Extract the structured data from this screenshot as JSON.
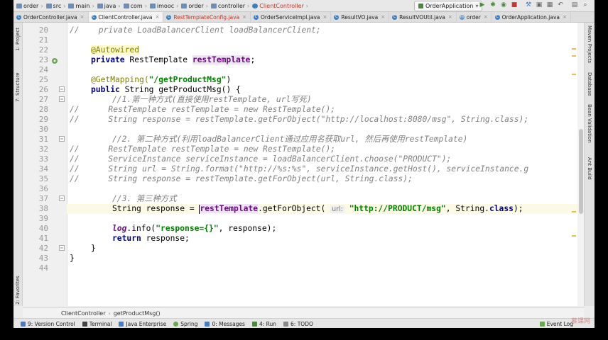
{
  "navbar": {
    "crumbs": [
      {
        "label": "order",
        "color": "#6b8fb8"
      },
      {
        "label": "src",
        "color": "#6b8fb8"
      },
      {
        "label": "main",
        "color": "#6b8fb8"
      },
      {
        "label": "java",
        "color": "#6b8fb8"
      },
      {
        "label": "com",
        "color": "#6b8fb8"
      },
      {
        "label": "imooc",
        "color": "#6b8fb8"
      },
      {
        "label": "order",
        "color": "#6b8fb8"
      },
      {
        "label": "controller",
        "color": "#6b8fb8"
      },
      {
        "label": "ClientController",
        "color": "#3a7fc1"
      }
    ],
    "run_config": "OrderApplication"
  },
  "tabs": [
    {
      "label": "OrderController.java",
      "active": false
    },
    {
      "label": "ClientController.java",
      "active": true
    },
    {
      "label": "RestTemplateConfig.java",
      "active": false
    },
    {
      "label": "OrderServiceImpl.java",
      "active": false
    },
    {
      "label": "ResultVO.java",
      "active": false
    },
    {
      "label": "ResultVOUtil.java",
      "active": false
    },
    {
      "label": "order",
      "active": false
    },
    {
      "label": "OrderApplication.java",
      "active": false
    }
  ],
  "left_tools": [
    "1: Project",
    "7: Structure",
    "2: Favorites"
  ],
  "right_tools": [
    "Maven Projects",
    "Database",
    "Bean Validation",
    "Ant Build"
  ],
  "editor": {
    "line_numbers": [
      "20",
      "21",
      "22",
      "23",
      "24",
      "25",
      "26",
      "27",
      "28",
      "29",
      "30",
      "31",
      "32",
      "33",
      "34",
      "35",
      "36",
      "37",
      "38",
      "39",
      "40",
      "41",
      "42",
      "43",
      "44"
    ],
    "lines": {
      "l20": "//    private LoadBalancerClient loadBalancerClient;",
      "l22_ann": "@Autowired",
      "l23_a": "private",
      "l23_b": " RestTemplate ",
      "l23_c": "restTemplate",
      "l23_d": ";",
      "l25_ann": "@GetMapping(",
      "l25_str": "\"/getProductMsg\"",
      "l25_end": ")",
      "l26_a": "public",
      "l26_b": " String getProductMsg() {",
      "l27": "//1.第一种方式(直接使用restTemplate, url写死)",
      "l28": "//      RestTemplate restTemplate = new RestTemplate();",
      "l29": "//      String response = restTemplate.getForObject(\"http://localhost:8080/msg\", String.class);",
      "l31": "//2. 第二种方式(利用loadBalancerClient通过应用名获取url, 然后再使用restTemplate)",
      "l32": "//      RestTemplate restTemplate = new RestTemplate();",
      "l33": "//      ServiceInstance serviceInstance = loadBalancerClient.choose(\"PRODUCT\");",
      "l34": "//      String url = String.format(\"http://%s:%s\", serviceInstance.getHost(), serviceInstance.g",
      "l35": "//      String response = restTemplate.getForObject(url, String.class);",
      "l37": "//3. 第三种方式",
      "l38_a": "String response = ",
      "l38_b": "restTemplate",
      "l38_c": ".getForObject( ",
      "l38_hint": "url:",
      "l38_str": "\"http://PRODUCT/msg\"",
      "l38_d": ", String.",
      "l38_kw": "class",
      "l38_e": ");",
      "l40_log": "log",
      "l40_a": ".info(",
      "l40_str": "\"response={}\"",
      "l40_b": ", response);",
      "l41_kw": "return",
      "l41_b": " response;",
      "l42": "}",
      "l43": "}"
    }
  },
  "method_breadcrumb": [
    "ClientController",
    "getProductMsg()"
  ],
  "tool_windows": [
    {
      "label": "9: Version Control",
      "color": "#4a7dbf"
    },
    {
      "label": "Terminal",
      "color": "#444444"
    },
    {
      "label": "Java Enterprise",
      "color": "#4a7dbf"
    },
    {
      "label": "Spring",
      "color": "#6aa84f"
    },
    {
      "label": "0: Messages",
      "color": "#4a7dbf"
    },
    {
      "label": "4: Run",
      "color": "#4a8b3a"
    },
    {
      "label": "6: TODO",
      "color": "#888888"
    }
  ],
  "event_log": "Event Log",
  "watermark": "慕课网"
}
